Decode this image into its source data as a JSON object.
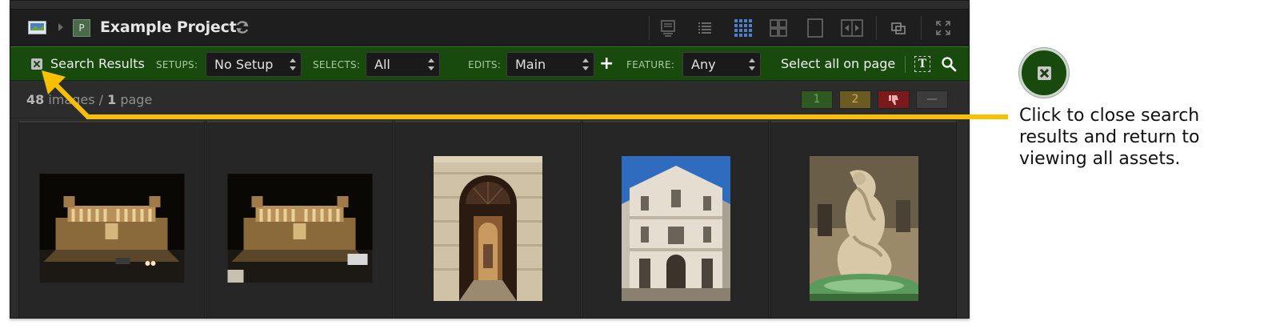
{
  "header": {
    "project_badge": "P",
    "project_title": "Example Project"
  },
  "searchbar": {
    "title": "Search Results",
    "setups_label": "SETUPS:",
    "setups_value": "No Setup",
    "selects_label": "SELECTS:",
    "selects_value": "All",
    "edits_label": "EDITS:",
    "edits_value": "Main",
    "add_label": "+",
    "feature_label": "FEATURE:",
    "feature_value": "Any",
    "select_all": "Select all on page",
    "text_toggle": "T"
  },
  "count": {
    "images_num": "48",
    "images_word": "images",
    "sep": "/",
    "pages_num": "1",
    "pages_word": "page"
  },
  "ratings": [
    "1",
    "2",
    "",
    "—"
  ],
  "colors": {
    "green_bar": "#174a0c",
    "callout": "#f8c000"
  },
  "callout": {
    "text": "Click to close search results and return to viewing all assets."
  }
}
